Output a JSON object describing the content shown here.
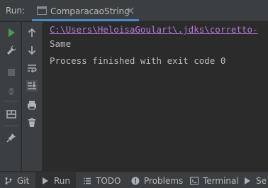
{
  "header": {
    "run_label": "Run:",
    "tab_title": "ComparacaoString"
  },
  "console": {
    "command_line": "C:\\Users\\HeloisaGoulart\\.jdks\\corretto-",
    "output_lines": [
      "Same",
      "Process finished with exit code 0"
    ]
  },
  "bottom_bar": {
    "items": [
      "Git",
      "Run",
      "TODO",
      "Problems",
      "Terminal",
      "Se"
    ]
  },
  "colors": {
    "accent": "#4a88c7",
    "command": "#b477d5",
    "run_green": "#499c54"
  }
}
